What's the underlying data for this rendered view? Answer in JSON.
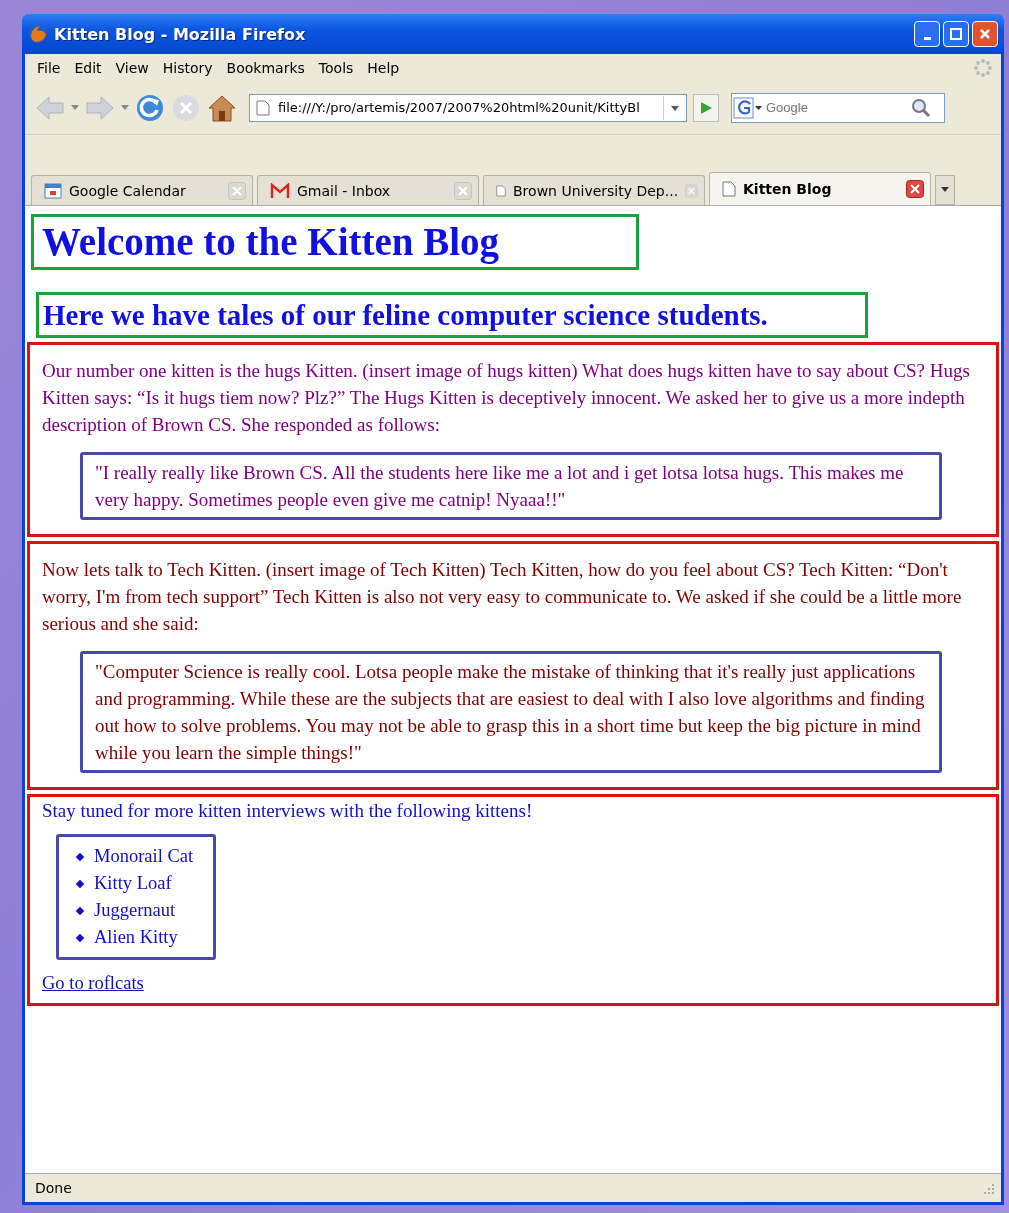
{
  "window": {
    "title": "Kitten Blog - Mozilla Firefox"
  },
  "menu": [
    "File",
    "Edit",
    "View",
    "History",
    "Bookmarks",
    "Tools",
    "Help"
  ],
  "address": {
    "value": "file:///Y:/pro/artemis/2007/2007%20html%20unit/KittyBl"
  },
  "search": {
    "placeholder": "Google"
  },
  "tabs": [
    {
      "label": "Google Calendar",
      "kind": "calendar",
      "selected": false
    },
    {
      "label": "Gmail - Inbox",
      "kind": "mail",
      "selected": false
    },
    {
      "label": "Brown University Dep...",
      "kind": "page",
      "selected": false
    },
    {
      "label": "Kitten Blog",
      "kind": "page",
      "selected": true
    }
  ],
  "page": {
    "heading": "Welcome to the Kitten Blog",
    "subheading": "Here we have tales of our feline computer science students.",
    "interviews": [
      {
        "text": "Our number one kitten is the hugs Kitten. (insert image of hugs kitten) What does hugs kitten have to say about CS? Hugs Kitten says: “Is it hugs tiem now? Plz?” The Hugs Kitten is deceptively innocent. We asked her to give us a more indepth description of Brown CS. She responded as follows:",
        "quote": "\"I really really like Brown CS. All the students here like me a lot and i get lotsa lotsa hugs. This makes me very happy. Sometimes people even give me catnip! Nyaaa!!\"",
        "color": "#800080"
      },
      {
        "text": "Now lets talk to Tech Kitten. (insert image of Tech Kitten) Tech Kitten, how do you feel about CS? Tech Kitten: “Don't worry, I'm from tech support” Tech Kitten is also not very easy to communicate to. We asked if she could be a little more serious and she said:",
        "quote": "\"Computer Science is really cool. Lotsa people make the mistake of thinking that it's really just applications and programming. While these are the subjects that are easiest to deal with I also love algorithms and finding out how to solve problems. You may not be able to grasp this in a short time but keep the big picture in mind while you learn the simple things!\"",
        "color": "#800000"
      }
    ],
    "upcoming": {
      "text": "Stay tuned for more kitten interviews with the following kittens!",
      "kittens": [
        "Monorail Cat",
        "Kitty Loaf",
        "Juggernaut",
        "Alien Kitty"
      ],
      "link": "Go to roflcats"
    }
  },
  "status_bar": "Done"
}
